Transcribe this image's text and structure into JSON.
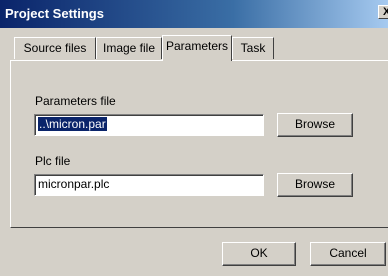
{
  "window": {
    "title": "Project Settings",
    "close_glyph": "X"
  },
  "tabs": [
    {
      "label": "Source files",
      "active": false
    },
    {
      "label": "Image file",
      "active": false
    },
    {
      "label": "Parameters",
      "active": true
    },
    {
      "label": "Task",
      "active": false
    }
  ],
  "parameters": {
    "params_label": "Parameters file",
    "params_value": "..\\micron.par",
    "params_browse": "Browse",
    "plc_label": "Plc file",
    "plc_value": "micronpar.plc",
    "plc_browse": "Browse"
  },
  "footer": {
    "ok_label": "OK",
    "cancel_label": "Cancel"
  }
}
